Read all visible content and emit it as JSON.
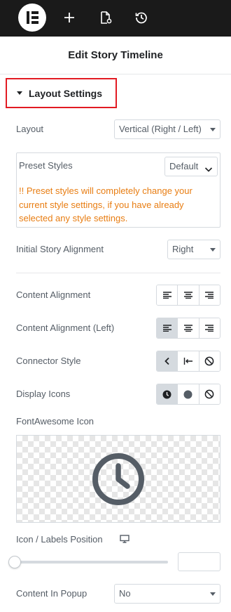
{
  "toolbar": {
    "logo_icon": "elementor-logo-icon",
    "buttons": [
      "add-icon",
      "page-settings-icon",
      "history-icon"
    ]
  },
  "panel": {
    "title": "Edit Story Timeline"
  },
  "section": {
    "title": "Layout Settings"
  },
  "layout": {
    "label": "Layout",
    "value": "Vertical (Right / Left)"
  },
  "preset": {
    "label": "Preset Styles",
    "value": "Default",
    "warning": "!! Preset styles will completely change your current style settings, if you have already selected any style settings."
  },
  "initial_alignment": {
    "label": "Initial Story Alignment",
    "value": "Right"
  },
  "content_alignment": {
    "label": "Content Alignment",
    "active": null,
    "options": [
      "align-left-icon",
      "align-center-icon",
      "align-right-icon"
    ]
  },
  "content_alignment_left": {
    "label": "Content Alignment (Left)",
    "active": 0,
    "options": [
      "align-left-icon",
      "align-center-icon",
      "align-right-icon"
    ]
  },
  "connector_style": {
    "label": "Connector Style",
    "active": 0,
    "options": [
      "chevron-left-icon",
      "bar-arrow-left-icon",
      "ban-icon"
    ]
  },
  "display_icons": {
    "label": "Display Icons",
    "active": 0,
    "options": [
      "clock-icon",
      "dot-icon",
      "ban-icon"
    ]
  },
  "fontawesome": {
    "label": "FontAwesome Icon",
    "icon": "clock-icon"
  },
  "icon_labels_position": {
    "label": "Icon / Labels Position",
    "device_icon": "desktop-icon",
    "value": 0,
    "input_value": ""
  },
  "content_popup": {
    "label": "Content In Popup",
    "value": "No"
  },
  "colors": {
    "warning": "#e87d12",
    "highlight": "#e21b23",
    "topbar": "#1a1a1a"
  }
}
